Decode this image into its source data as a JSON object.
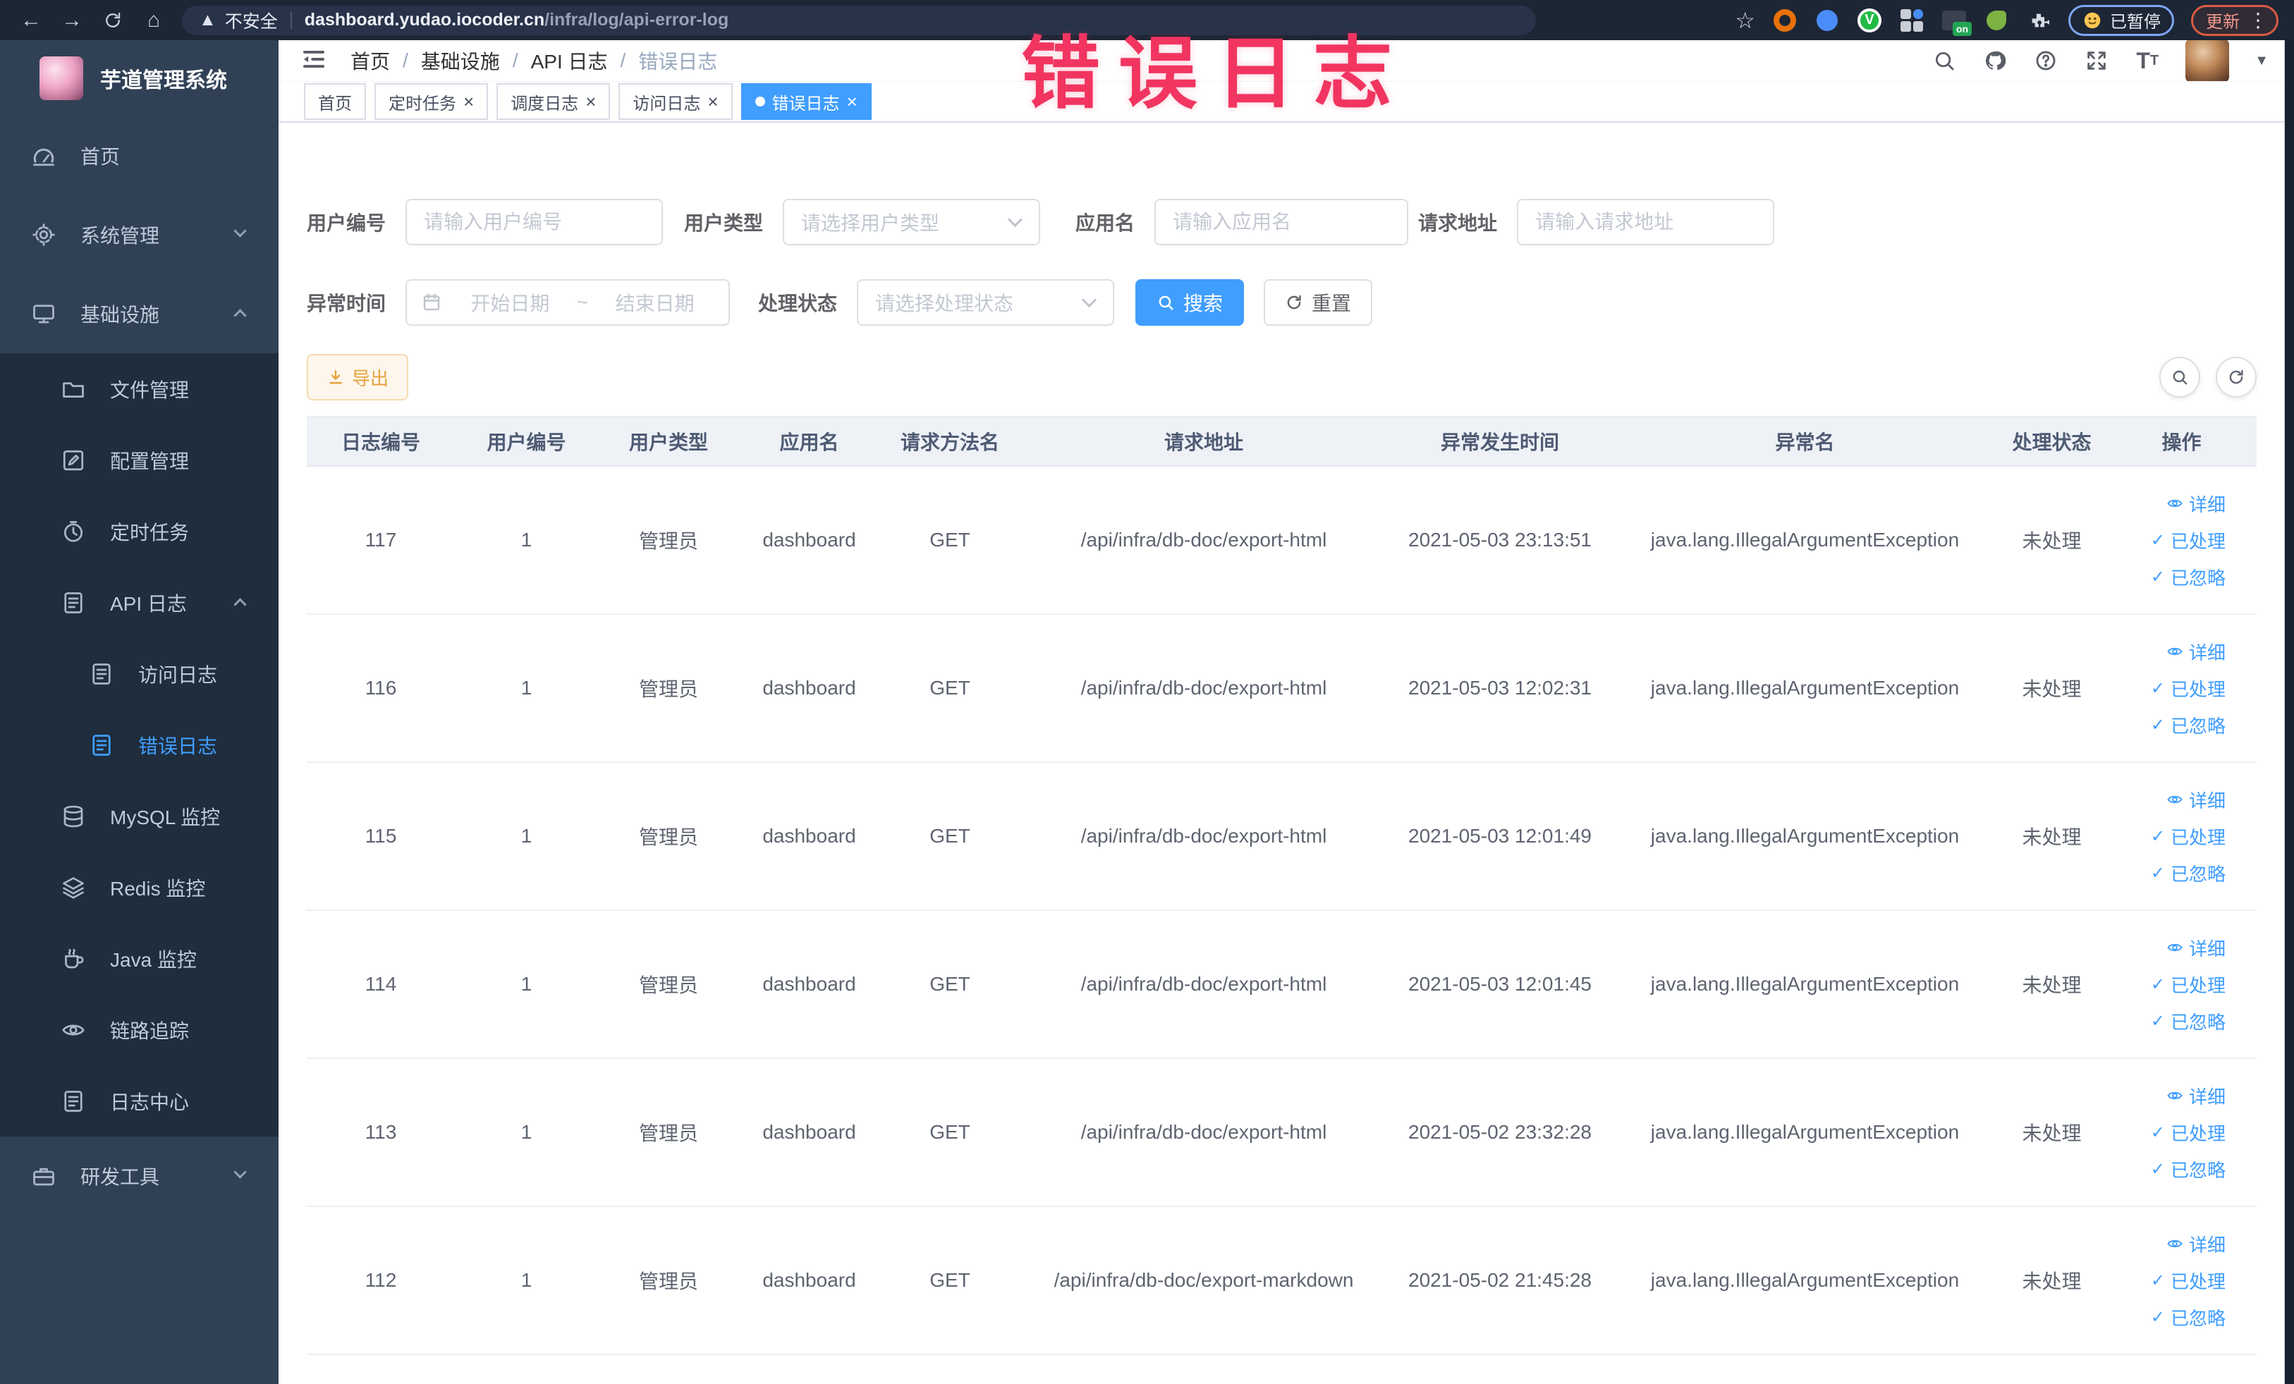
{
  "browser": {
    "security_label": "不安全",
    "url_host": "dashboard.yudao.iocoder.cn",
    "url_path": "/infra/log/api-error-log",
    "ext_on_badge": "on",
    "paused_chip_label": "已暂停",
    "update_button_label": "更新"
  },
  "overlay": {
    "title": "错误日志"
  },
  "sidebar": {
    "title": "芋道管理系统",
    "items": [
      {
        "key": "home",
        "label": "首页",
        "icon": "dashboard-icon",
        "depth": 0
      },
      {
        "key": "system",
        "label": "系统管理",
        "icon": "gear-icon",
        "depth": 0,
        "arrow": "down"
      },
      {
        "key": "infra",
        "label": "基础设施",
        "icon": "infrastructure-icon",
        "depth": 0,
        "arrow": "up"
      },
      {
        "key": "file",
        "label": "文件管理",
        "icon": "folder-icon",
        "depth": 1
      },
      {
        "key": "config",
        "label": "配置管理",
        "icon": "edit-icon",
        "depth": 1
      },
      {
        "key": "job",
        "label": "定时任务",
        "icon": "timer-icon",
        "depth": 1
      },
      {
        "key": "api-log",
        "label": "API 日志",
        "icon": "log-icon",
        "depth": 1,
        "arrow": "up"
      },
      {
        "key": "access-log",
        "label": "访问日志",
        "icon": "log-icon",
        "depth": 2
      },
      {
        "key": "error-log",
        "label": "错误日志",
        "icon": "log-icon",
        "depth": 2,
        "active": true
      },
      {
        "key": "mysql",
        "label": "MySQL 监控",
        "icon": "database-icon",
        "depth": 1
      },
      {
        "key": "redis",
        "label": "Redis 监控",
        "icon": "layers-icon",
        "depth": 1
      },
      {
        "key": "java",
        "label": "Java 监控",
        "icon": "coffee-icon",
        "depth": 1
      },
      {
        "key": "trace",
        "label": "链路追踪",
        "icon": "eye-icon",
        "depth": 1
      },
      {
        "key": "log-center",
        "label": "日志中心",
        "icon": "log-icon",
        "depth": 1
      },
      {
        "key": "dev-tools",
        "label": "研发工具",
        "icon": "briefcase-icon",
        "depth": 0,
        "arrow": "down"
      }
    ]
  },
  "header": {
    "breadcrumb": [
      "首页",
      "基础设施",
      "API 日志",
      "错误日志"
    ],
    "separator": "/"
  },
  "tabs": [
    {
      "label": "首页",
      "closable": false,
      "active": false
    },
    {
      "label": "定时任务",
      "closable": true,
      "active": false
    },
    {
      "label": "调度日志",
      "closable": true,
      "active": false
    },
    {
      "label": "访问日志",
      "closable": true,
      "active": false
    },
    {
      "label": "错误日志",
      "closable": true,
      "active": true
    }
  ],
  "filters": {
    "user_id": {
      "label": "用户编号",
      "placeholder": "请输入用户编号"
    },
    "user_type": {
      "label": "用户类型",
      "placeholder": "请选择用户类型"
    },
    "app_name": {
      "label": "应用名",
      "placeholder": "请输入应用名"
    },
    "request_url": {
      "label": "请求地址",
      "placeholder": "请输入请求地址"
    },
    "exception_time": {
      "label": "异常时间",
      "start_placeholder": "开始日期",
      "separator": "~",
      "end_placeholder": "结束日期"
    },
    "process_status": {
      "label": "处理状态",
      "placeholder": "请选择处理状态"
    },
    "search_label": "搜索",
    "reset_label": "重置"
  },
  "toolbar": {
    "export_label": "导出"
  },
  "table": {
    "columns": [
      "日志编号",
      "用户编号",
      "用户类型",
      "应用名",
      "请求方法名",
      "请求地址",
      "异常发生时间",
      "异常名",
      "处理状态",
      "操作"
    ],
    "rows": [
      {
        "id": "117",
        "user_id": "1",
        "user_type": "管理员",
        "app": "dashboard",
        "method": "GET",
        "url": "/api/infra/db-doc/export-html",
        "time": "2021-05-03 23:13:51",
        "exception": "java.lang.IllegalArgumentException",
        "status": "未处理"
      },
      {
        "id": "116",
        "user_id": "1",
        "user_type": "管理员",
        "app": "dashboard",
        "method": "GET",
        "url": "/api/infra/db-doc/export-html",
        "time": "2021-05-03 12:02:31",
        "exception": "java.lang.IllegalArgumentException",
        "status": "未处理"
      },
      {
        "id": "115",
        "user_id": "1",
        "user_type": "管理员",
        "app": "dashboard",
        "method": "GET",
        "url": "/api/infra/db-doc/export-html",
        "time": "2021-05-03 12:01:49",
        "exception": "java.lang.IllegalArgumentException",
        "status": "未处理"
      },
      {
        "id": "114",
        "user_id": "1",
        "user_type": "管理员",
        "app": "dashboard",
        "method": "GET",
        "url": "/api/infra/db-doc/export-html",
        "time": "2021-05-03 12:01:45",
        "exception": "java.lang.IllegalArgumentException",
        "status": "未处理"
      },
      {
        "id": "113",
        "user_id": "1",
        "user_type": "管理员",
        "app": "dashboard",
        "method": "GET",
        "url": "/api/infra/db-doc/export-html",
        "time": "2021-05-02 23:32:28",
        "exception": "java.lang.IllegalArgumentException",
        "status": "未处理"
      },
      {
        "id": "112",
        "user_id": "1",
        "user_type": "管理员",
        "app": "dashboard",
        "method": "GET",
        "url": "/api/infra/db-doc/export-markdown",
        "time": "2021-05-02 21:45:28",
        "exception": "java.lang.IllegalArgumentException",
        "status": "未处理"
      }
    ],
    "actions": [
      {
        "label": "详细",
        "icon": "eye-icon"
      },
      {
        "label": "已处理",
        "icon": "check-icon"
      },
      {
        "label": "已忽略",
        "icon": "check-icon"
      }
    ]
  },
  "colors": {
    "accent": "#409eff",
    "sidebar_bg": "#304156",
    "submenu_bg": "#1f2d3d",
    "warning": "#e6a23c",
    "annotation_red": "#f13560"
  }
}
